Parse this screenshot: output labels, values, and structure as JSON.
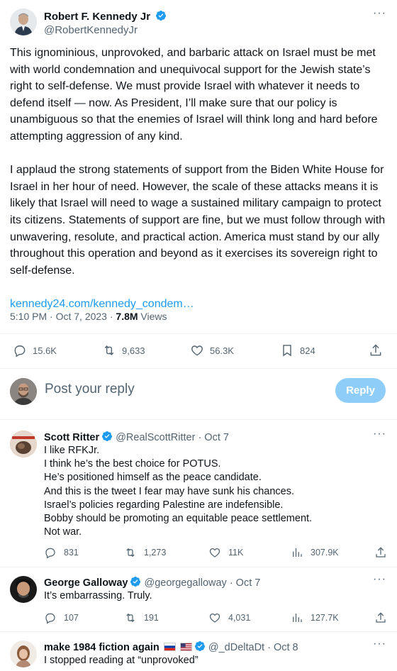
{
  "main_tweet": {
    "author_name": "Robert F. Kennedy Jr",
    "author_handle": "@RobertKennedyJr",
    "paragraphs": [
      "This ignominious, unprovoked, and barbaric attack on Israel must be met with world condemnation and unequivocal support for the Jewish state’s right to self-defense. We must provide Israel with whatever it needs to defend itself — now. As President, I’ll make sure that our policy is unambiguous so that the enemies of Israel will think long and hard before attempting aggression of any kind.",
      "I applaud the strong statements of support from the Biden White House for Israel in her hour of need. However, the scale of these attacks means it is likely that Israel will need to wage a sustained military campaign to protect its citizens. Statements of support are fine, but we must follow through with unwavering, resolute, and practical action. America must stand by our ally throughout this operation and beyond as it exercises its sovereign right to self-defense."
    ],
    "link": "kennedy24.com/kennedy_condem…",
    "timestamp": "5:10 PM · Oct 7, 2023 · ",
    "views_count": "7.8M",
    "views_label": " Views",
    "actions": {
      "replies": "15.6K",
      "reposts": "9,633",
      "likes": "56.3K",
      "bookmarks": "824"
    }
  },
  "composer": {
    "placeholder": "Post your reply",
    "button_label": "Reply"
  },
  "replies": [
    {
      "name": "Scott Ritter",
      "handle_date": "@RealScottRitter · Oct 7",
      "lines": [
        "I like RFKJr.",
        "I think he’s the best choice for POTUS.",
        "He’s positioned himself as the peace candidate.",
        "And this is the tweet I fear may have sunk his chances.",
        "Israel’s policies regarding Palestine are indefensible.",
        "Bobby should be promoting an equitable peace settlement.",
        "Not war."
      ],
      "actions": {
        "replies": "831",
        "reposts": "1,273",
        "likes": "11K",
        "views": "307.9K"
      }
    },
    {
      "name": "George Galloway",
      "handle_date": "@georgegalloway · Oct 7",
      "lines": [
        "It’s embarrassing. Truly."
      ],
      "actions": {
        "replies": "107",
        "reposts": "191",
        "likes": "4,031",
        "views": "127.7K"
      }
    },
    {
      "name": "make 1984 fiction again",
      "handle_date": "@_dDeltaDt · Oct 8",
      "lines": [
        "I stopped reading at “unprovoked”"
      ]
    }
  ],
  "colors": {
    "accent": "#1d9bf0",
    "secondary_text": "#536471",
    "reply_button_disabled": "#8ecdf7"
  }
}
